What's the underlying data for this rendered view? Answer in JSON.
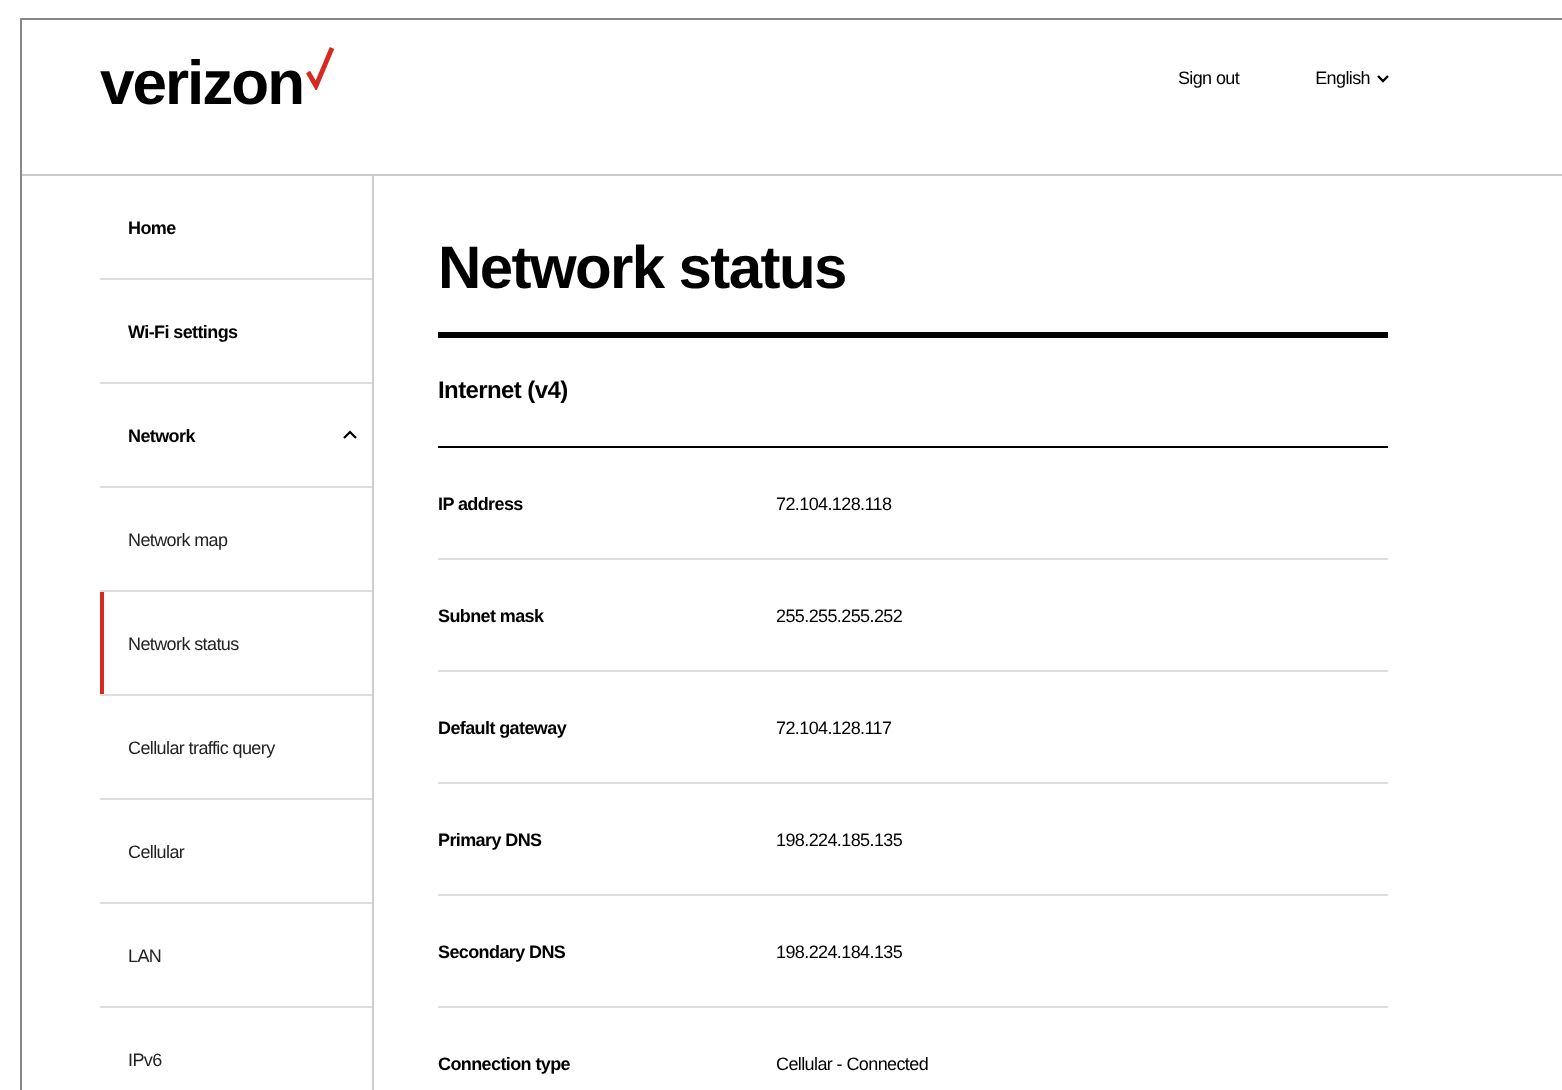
{
  "header": {
    "logo": "verizon",
    "links": [
      {
        "label": "Sign out",
        "kind": "link"
      },
      {
        "label": "English",
        "kind": "dropdown"
      }
    ]
  },
  "sidebar": {
    "items": [
      {
        "label": "Home",
        "selected": false
      },
      {
        "label": "Wi-Fi settings",
        "selected": false
      },
      {
        "label": "Network",
        "selected": false,
        "expanded": true,
        "children": [
          {
            "label": "Network map",
            "selected": false
          },
          {
            "label": "Network status",
            "selected": true
          },
          {
            "label": "Cellular traffic query",
            "selected": false
          },
          {
            "label": "Cellular",
            "selected": false
          },
          {
            "label": "LAN",
            "selected": false
          },
          {
            "label": "IPv6",
            "selected": false
          }
        ]
      }
    ]
  },
  "main": {
    "title": "Network status",
    "section": "Internet (v4)",
    "rows": [
      {
        "label": "IP address",
        "value": "72.104.128.118"
      },
      {
        "label": "Subnet mask",
        "value": "255.255.255.252"
      },
      {
        "label": "Default gateway",
        "value": "72.104.128.117"
      },
      {
        "label": "Primary DNS",
        "value": "198.224.185.135"
      },
      {
        "label": "Secondary DNS",
        "value": "198.224.184.135"
      },
      {
        "label": "Connection type",
        "value": "Cellular - Connected"
      }
    ]
  }
}
